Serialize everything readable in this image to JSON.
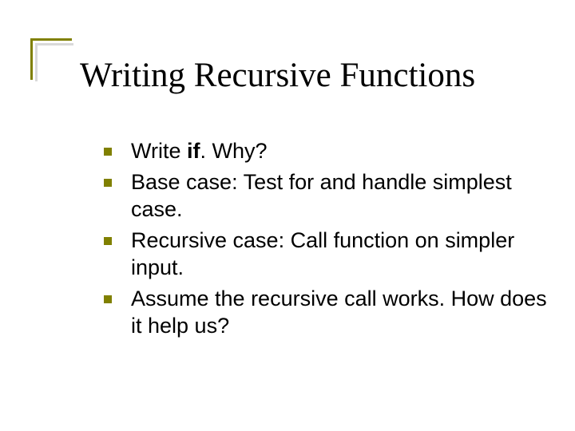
{
  "title": "Writing Recursive Functions",
  "bullets": [
    {
      "pre": "Write ",
      "bold": "if",
      "post": ".  Why?"
    },
    {
      "pre": "Base case:  Test for and handle simplest case.",
      "bold": "",
      "post": ""
    },
    {
      "pre": "Recursive case:  Call function on simpler input.",
      "bold": "",
      "post": ""
    },
    {
      "pre": "Assume the recursive call works.  How does it help us?",
      "bold": "",
      "post": ""
    }
  ]
}
